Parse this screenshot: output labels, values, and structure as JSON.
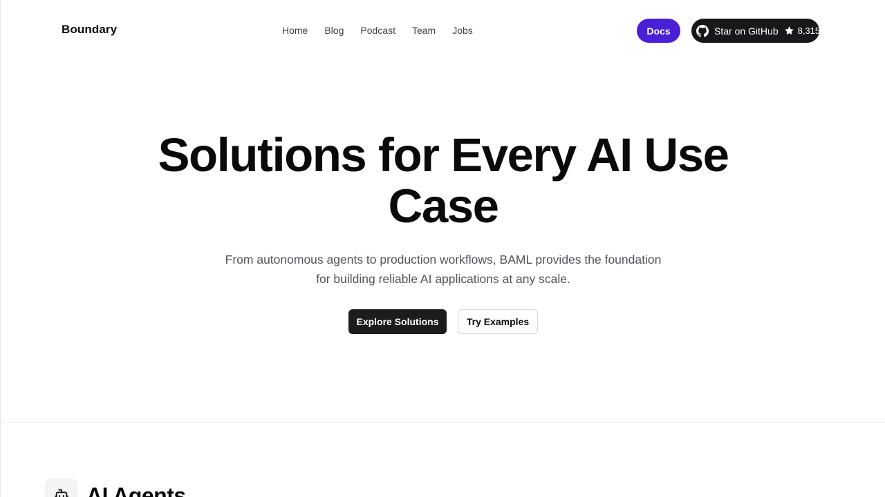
{
  "header": {
    "brand": "Boundary",
    "nav": [
      {
        "label": "Home"
      },
      {
        "label": "Blog"
      },
      {
        "label": "Podcast"
      },
      {
        "label": "Team"
      },
      {
        "label": "Jobs"
      }
    ],
    "docs_label": "Docs",
    "github": {
      "label": "Star on GitHub",
      "count": "8,315",
      "icon": "github-icon",
      "star_icon": "star-icon"
    }
  },
  "hero": {
    "title_line1": "Solutions for Every AI Use",
    "title_line2": "Case",
    "subtitle_line1": "From autonomous agents to production workflows, BAML provides the foundation",
    "subtitle_line2": "for building reliable AI applications at any scale.",
    "primary_button": "Explore Solutions",
    "secondary_button": "Try Examples"
  },
  "section": {
    "title": "AI Agents",
    "icon": "robot-icon"
  },
  "colors": {
    "accent": "#4a1fd6",
    "dark": "#18181b",
    "text": "#0a0a0a",
    "muted": "#52525b"
  }
}
